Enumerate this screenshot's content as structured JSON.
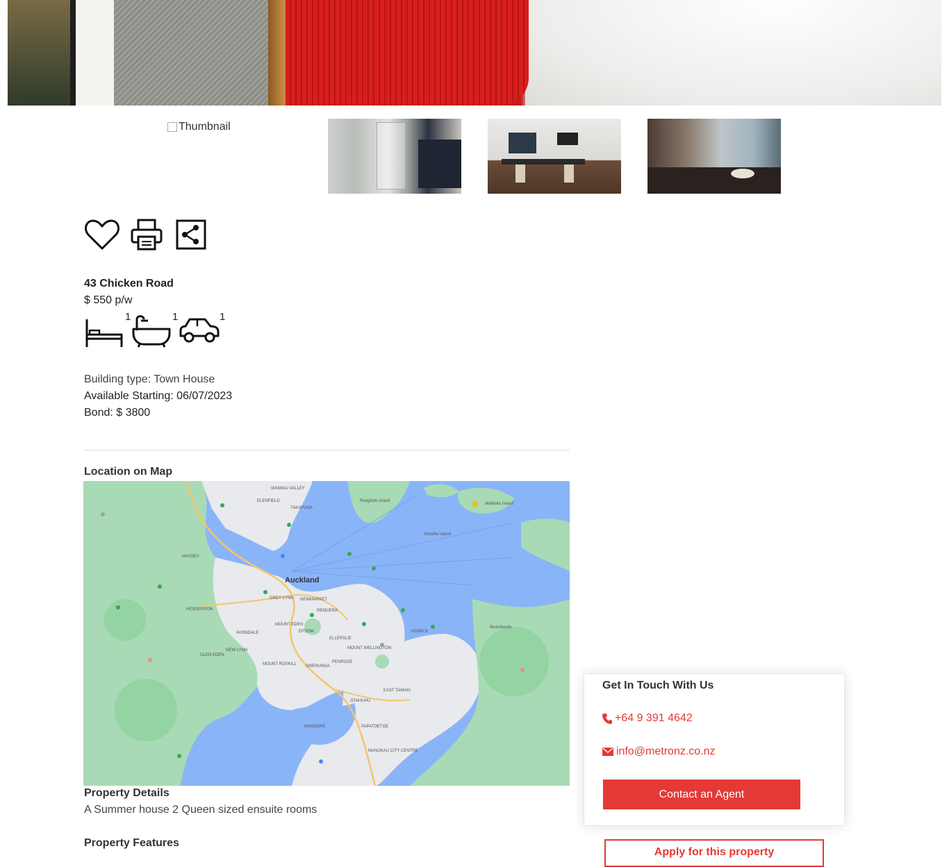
{
  "gallery": {
    "broken_thumbnail_alt": "Thumbnail"
  },
  "property": {
    "address": "43 Chicken Road",
    "price": "$ 550 p/w",
    "bedrooms": "1",
    "bathrooms": "1",
    "car_spaces": "1",
    "building_type": "Building type: Town House",
    "available_starting": "Available Starting: 06/07/2023",
    "bond": "Bond: $ 3800"
  },
  "map": {
    "heading": "Location on Map",
    "labels": [
      "WAIWAU VALLEY",
      "ELENFIELD",
      "TAKAPUNA",
      "Auckland",
      "GREY LYNN",
      "NEWMARKET",
      "MOUNT EDEN",
      "REMUERA",
      "ELLERSLIE",
      "EPSOM",
      "GLEN EDEN",
      "NEW LYNN",
      "AVONDALE",
      "HENDERSON",
      "MASSEY",
      "MOUNT ROSKILL",
      "ONEHUNGA",
      "PENROSE",
      "MOUNT WELLINGTON",
      "HOWICK",
      "EAST TAMAKI",
      "OTAHUHU",
      "MANGERE",
      "PAPATOETOE",
      "MANUKAU CITY CENTRE",
      "Beachlands",
      "Waiheke Island",
      "Rangitoto Island",
      "Motuihe Island"
    ]
  },
  "details": {
    "heading": "Property Details",
    "text": "A Summer house 2 Queen sized ensuite rooms",
    "features_heading": "Property Features"
  },
  "contact": {
    "title": "Get In Touch With Us",
    "phone": "+64 9 391 4642",
    "email": "info@metronz.co.nz",
    "button_label": "Contact an Agent",
    "apply_label": "Apply for this property"
  },
  "colors": {
    "accent": "#e53935",
    "map_water": "#8ab4f8",
    "map_land": "#a8dab5"
  },
  "icons": [
    "heart-icon",
    "printer-icon",
    "share-icon",
    "bed-icon",
    "bath-icon",
    "car-icon",
    "phone-icon",
    "envelope-icon"
  ]
}
